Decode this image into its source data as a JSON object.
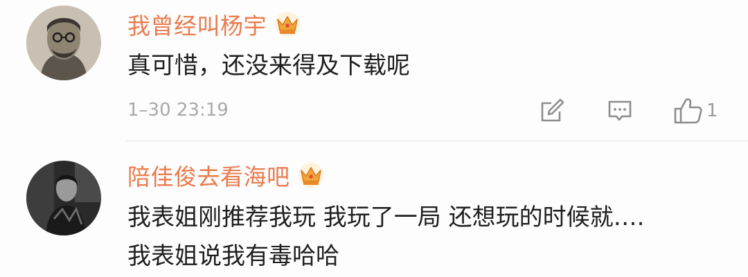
{
  "comments": [
    {
      "username": "我曾经叫杨宇",
      "text_lines": [
        "真可惜，还没来得及下载呢"
      ],
      "timestamp": "1–30 23:19",
      "like_count": "1",
      "vip_badge": "crown-badge",
      "avatar_icon": "avatar-user"
    },
    {
      "username": "陪佳俊去看海吧",
      "text_lines": [
        "我表姐刚推荐我玩 我玩了一局 还想玩的时候就….",
        "我表姐说我有毒哈哈"
      ],
      "vip_badge": "crown-badge",
      "avatar_icon": "avatar-user"
    }
  ],
  "actions": {
    "repost_icon": "edit-square-icon",
    "reply_icon": "comment-icon",
    "like_icon": "thumbs-up-icon"
  },
  "colors": {
    "username": "#ea7b4d",
    "text": "#1e1e1e",
    "meta": "#a8a8a8",
    "crown": "#f0a43a"
  }
}
